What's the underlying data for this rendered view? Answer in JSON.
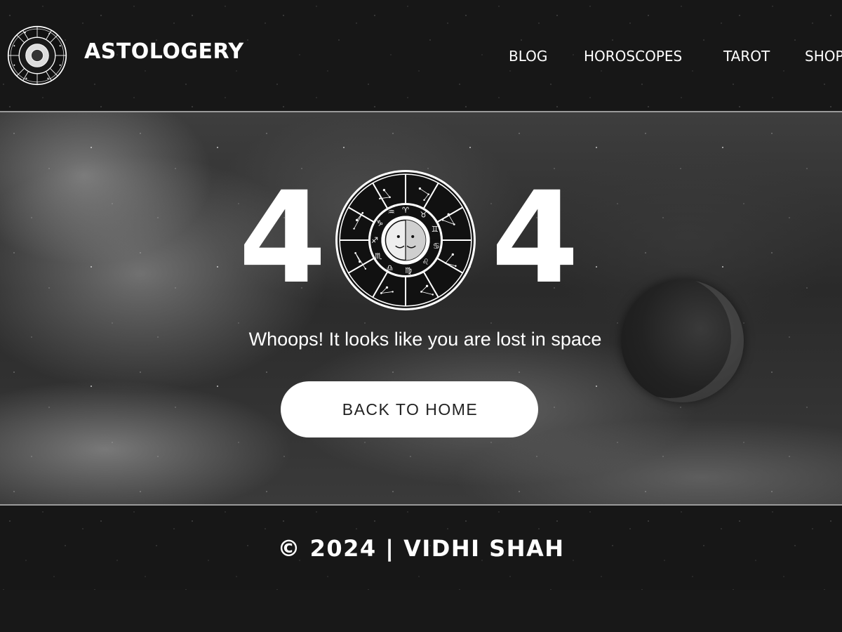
{
  "header": {
    "brand": "ASTOLOGERY",
    "logo_icon": "zodiac-wheel-icon",
    "nav": [
      {
        "label": "BLOG"
      },
      {
        "label": "HOROSCOPES"
      },
      {
        "label": "TAROT"
      },
      {
        "label": "SHOP"
      }
    ]
  },
  "hero": {
    "digit_left": "4",
    "digit_right": "4",
    "center_icon": "zodiac-wheel-icon",
    "message": "Whoops! It looks like you are lost in space",
    "button_label": "BACK TO HOME"
  },
  "footer": {
    "copyright": "© 2024 | VIDHI SHAH"
  },
  "colors": {
    "background": "#181818",
    "text": "#ffffff",
    "button_bg": "#ffffff",
    "button_text": "#222222",
    "divider": "#9a9a9a"
  }
}
